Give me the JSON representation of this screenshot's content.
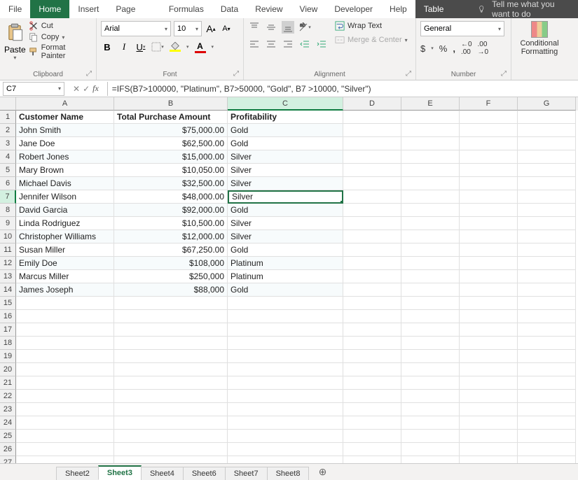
{
  "menu": {
    "items": [
      "File",
      "Home",
      "Insert",
      "Page Layout",
      "Formulas",
      "Data",
      "Review",
      "View",
      "Developer",
      "Help",
      "Table Design"
    ],
    "active": "Home",
    "tellme": "Tell me what you want to do"
  },
  "ribbon": {
    "clipboard": {
      "paste": "Paste",
      "cut": "Cut",
      "copy": "Copy",
      "painter": "Format Painter",
      "label": "Clipboard"
    },
    "font": {
      "name": "Arial",
      "size": "10",
      "bold": "B",
      "italic": "I",
      "underline": "U",
      "textA": "A",
      "label": "Font"
    },
    "alignment": {
      "wrap": "Wrap Text",
      "merge": "Merge & Center",
      "label": "Alignment"
    },
    "number": {
      "format": "General",
      "currency": "$",
      "percent": "%",
      "comma": ",",
      "label": "Number"
    },
    "cond_fmt": "Conditional\nFormatting"
  },
  "formula_bar": {
    "cell_ref": "C7",
    "fx": "fx",
    "formula": "=IFS(B7>100000, \"Platinum\", B7>50000, \"Gold\", B7 >10000, \"Silver\")"
  },
  "columns": [
    "A",
    "B",
    "C",
    "D",
    "E",
    "F",
    "G"
  ],
  "headers": {
    "A": "Customer Name",
    "B": "Total Purchase Amount",
    "C": "Profitability"
  },
  "rows": [
    {
      "n": 1,
      "a": "Customer Name",
      "b": "Total Purchase Amount",
      "c": "Profitability",
      "hdr": true
    },
    {
      "n": 2,
      "a": "John Smith",
      "b": "$75,000.00",
      "c": "Gold"
    },
    {
      "n": 3,
      "a": "Jane Doe",
      "b": "$62,500.00",
      "c": "Gold"
    },
    {
      "n": 4,
      "a": "Robert Jones",
      "b": "$15,000.00",
      "c": "Silver"
    },
    {
      "n": 5,
      "a": "Mary Brown",
      "b": "$10,050.00",
      "c": "Silver"
    },
    {
      "n": 6,
      "a": "Michael Davis",
      "b": "$32,500.00",
      "c": "Silver"
    },
    {
      "n": 7,
      "a": "Jennifer Wilson",
      "b": "$48,000.00",
      "c": "Silver",
      "sel": true
    },
    {
      "n": 8,
      "a": "David Garcia",
      "b": "$92,000.00",
      "c": "Gold"
    },
    {
      "n": 9,
      "a": "Linda Rodriguez",
      "b": "$10,500.00",
      "c": "Silver"
    },
    {
      "n": 10,
      "a": "Christopher Williams",
      "b": "$12,000.00",
      "c": "Silver"
    },
    {
      "n": 11,
      "a": "Susan Miller",
      "b": "$67,250.00",
      "c": "Gold"
    },
    {
      "n": 12,
      "a": "Emily Doe",
      "b": "$108,000",
      "c": "Platinum"
    },
    {
      "n": 13,
      "a": "Marcus Miller",
      "b": "$250,000",
      "c": "Platinum"
    },
    {
      "n": 14,
      "a": "James Joseph",
      "b": "$88,000",
      "c": "Gold"
    }
  ],
  "empty_rows": [
    15,
    16,
    17,
    18,
    19,
    20,
    21,
    22,
    23,
    24,
    25,
    26,
    27
  ],
  "sheets": {
    "tabs": [
      "Sheet2",
      "Sheet3",
      "Sheet4",
      "Sheet6",
      "Sheet7",
      "Sheet8"
    ],
    "active": "Sheet3"
  },
  "chart_data": {
    "type": "table",
    "title": "",
    "columns": [
      "Customer Name",
      "Total Purchase Amount",
      "Profitability"
    ],
    "data": [
      [
        "John Smith",
        75000.0,
        "Gold"
      ],
      [
        "Jane Doe",
        62500.0,
        "Gold"
      ],
      [
        "Robert Jones",
        15000.0,
        "Silver"
      ],
      [
        "Mary Brown",
        10050.0,
        "Silver"
      ],
      [
        "Michael Davis",
        32500.0,
        "Silver"
      ],
      [
        "Jennifer Wilson",
        48000.0,
        "Silver"
      ],
      [
        "David Garcia",
        92000.0,
        "Gold"
      ],
      [
        "Linda Rodriguez",
        10500.0,
        "Silver"
      ],
      [
        "Christopher Williams",
        12000.0,
        "Silver"
      ],
      [
        "Susan Miller",
        67250.0,
        "Gold"
      ],
      [
        "Emily Doe",
        108000,
        "Platinum"
      ],
      [
        "Marcus Miller",
        250000,
        "Platinum"
      ],
      [
        "James Joseph",
        88000,
        "Gold"
      ]
    ]
  }
}
